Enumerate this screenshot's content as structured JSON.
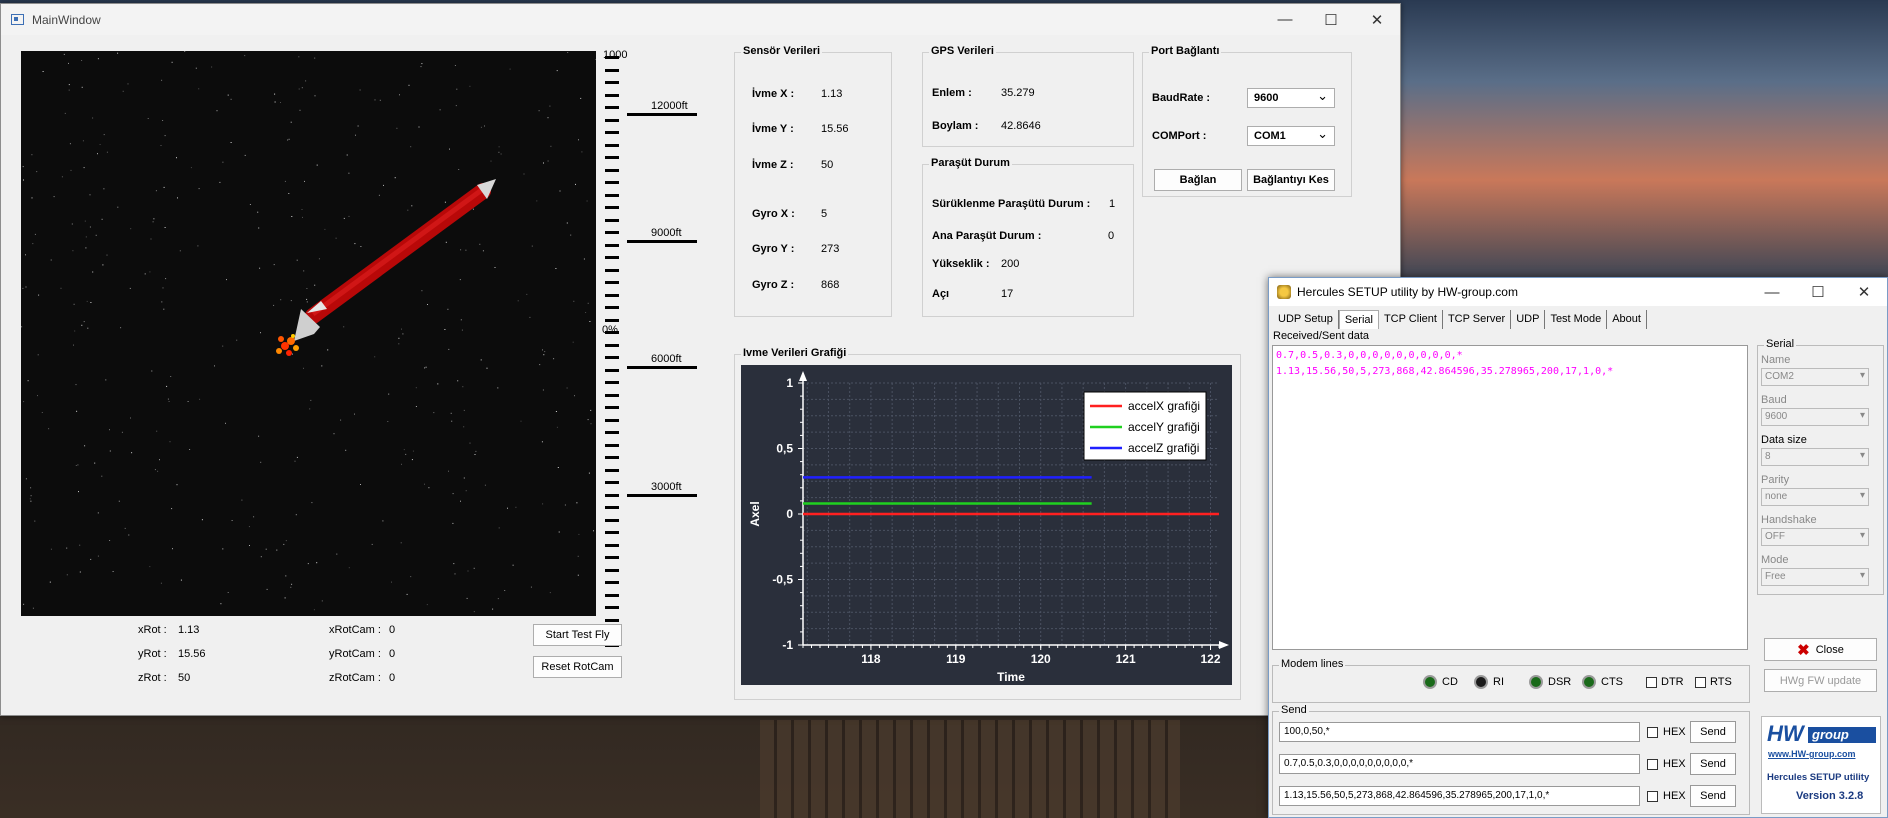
{
  "main_window": {
    "title": "MainWindow",
    "controls": {
      "minimize": "—",
      "maximize": "☐",
      "close": "✕"
    },
    "altimeter": {
      "top_label": "1000",
      "pct_label": "0%",
      "marks": [
        "12000ft",
        "9000ft",
        "6000ft",
        "3000ft"
      ]
    },
    "rotation": {
      "xRot_label": "xRot :",
      "xRot": "1.13",
      "yRot_label": "yRot :",
      "yRot": "15.56",
      "zRot_label": "zRot :",
      "zRot": "50",
      "xRotCam_label": "xRotCam :",
      "xRotCam": "0",
      "yRotCam_label": "yRotCam :",
      "yRotCam": "0",
      "zRotCam_label": "zRotCam :",
      "zRotCam": "0"
    },
    "buttons": {
      "start_test": "Start Test Fly",
      "reset_rotcam": "Reset RotCam"
    },
    "sensor": {
      "title": "Sensör Verileri",
      "ivme_x_label": "İvme X :",
      "ivme_x": "1.13",
      "ivme_y_label": "İvme Y :",
      "ivme_y": "15.56",
      "ivme_z_label": "İvme Z :",
      "ivme_z": "50",
      "gyro_x_label": "Gyro X :",
      "gyro_x": "5",
      "gyro_y_label": "Gyro Y :",
      "gyro_y": "273",
      "gyro_z_label": "Gyro Z :",
      "gyro_z": "868"
    },
    "gps": {
      "title": "GPS Verileri",
      "enlem_label": "Enlem :",
      "enlem": "35.279",
      "boylam_label": "Boylam :",
      "boylam": "42.8646"
    },
    "parachute": {
      "title": "Paraşüt Durum",
      "drogue_label": "Sürüklenme Paraşütü Durum :",
      "drogue": "1",
      "main_label": "Ana Paraşüt Durum :",
      "main": "0",
      "altitude_label": "Yükseklik :",
      "altitude": "200",
      "angle_label": "Açı",
      "angle": "17"
    },
    "port": {
      "title": "Port Bağlantı",
      "baud_label": "BaudRate :",
      "baud": "9600",
      "com_label": "COMPort :",
      "com": "COM1",
      "connect": "Bağlan",
      "disconnect": "Bağlantıyı Kes"
    },
    "chart_title": "Ivme Verileri Grafiği"
  },
  "chart_data": {
    "type": "line",
    "title": "",
    "xlabel": "Time",
    "ylabel": "Axel",
    "xlim": [
      117.2,
      122.1
    ],
    "ylim": [
      -1,
      1
    ],
    "x_ticks": [
      "118",
      "119",
      "120",
      "121",
      "122"
    ],
    "y_ticks": [
      "1",
      "0,5",
      "0",
      "-0,5",
      "-1"
    ],
    "legend_position": "top-right",
    "series": [
      {
        "name": "accelX grafiği",
        "color": "#ff2020",
        "x": [
          117.2,
          120.6,
          122.1
        ],
        "y": [
          0,
          0,
          0
        ]
      },
      {
        "name": "accelY grafiği",
        "color": "#20d020",
        "x": [
          117.2,
          120.6
        ],
        "y": [
          0.08,
          0.08
        ]
      },
      {
        "name": "accelZ grafiği",
        "color": "#2020ff",
        "x": [
          117.2,
          120.6
        ],
        "y": [
          0.28,
          0.28
        ]
      }
    ]
  },
  "hercules": {
    "title": "Hercules SETUP utility by HW-group.com",
    "tabs": [
      "UDP Setup",
      "Serial",
      "TCP Client",
      "TCP Server",
      "UDP",
      "Test Mode",
      "About"
    ],
    "received_label": "Received/Sent data",
    "received_lines": [
      "0.7,0.5,0.3,0,0,0,0,0,0,0,0,0,*",
      "1.13,15.56,50,5,273,868,42.864596,35.278965,200,17,1,0,*"
    ],
    "serial": {
      "title": "Serial",
      "name_label": "Name",
      "name": "COM2",
      "baud_label": "Baud",
      "baud": "9600",
      "datasize_label": "Data size",
      "datasize": "8",
      "parity_label": "Parity",
      "parity": "none",
      "handshake_label": "Handshake",
      "handshake": "OFF",
      "mode_label": "Mode",
      "mode": "Free"
    },
    "close_label": "Close",
    "hwg_update": "HWg FW update",
    "modem": {
      "title": "Modem lines",
      "cd": "CD",
      "ri": "RI",
      "dsr": "DSR",
      "cts": "CTS",
      "dtr": "DTR",
      "rts": "RTS"
    },
    "send": {
      "title": "Send",
      "lines": [
        "100,0,50,*",
        "0.7,0.5,0.3,0,0,0,0,0,0,0,0,0,*",
        "1.13,15.56,50,5,273,868,42.864596,35.278965,200,17,1,0,*"
      ],
      "hex_label": "HEX",
      "send_label": "Send"
    },
    "logo": {
      "brand": "HW",
      "sub": "group",
      "url": "www.HW-group.com",
      "name": "Hercules SETUP utility",
      "version": "Version  3.2.8"
    }
  }
}
